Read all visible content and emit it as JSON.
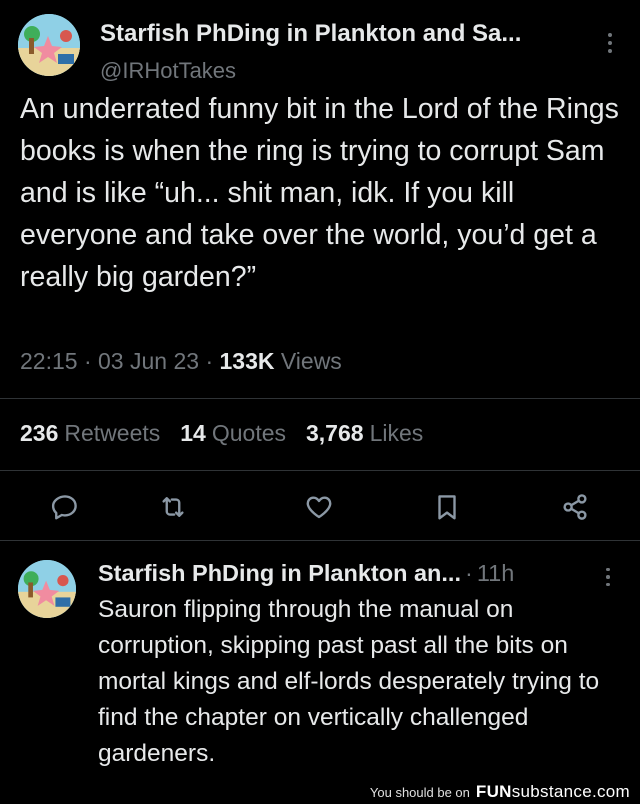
{
  "main_tweet": {
    "author_name": "Starfish PhDing in Plankton and Sa...",
    "author_handle": "@IRHotTakes",
    "text": "An underrated funny bit in the Lord of the Rings books is when the ring is trying to corrupt Sam and is like “uh... shit man, idk. If you kill everyone and take over the world, you’d get a really big garden?”",
    "time": "22:15",
    "date": "03 Jun 23",
    "views_count": "133K",
    "views_label": "Views",
    "separator": "·",
    "retweets_count": "236",
    "retweets_label": "Retweets",
    "quotes_count": "14",
    "quotes_label": "Quotes",
    "likes_count": "3,768",
    "likes_label": "Likes"
  },
  "actions": {
    "icons": [
      "reply-icon",
      "retweet-icon",
      "like-icon",
      "bookmark-icon",
      "share-icon"
    ],
    "icon_color": "#8b98a5"
  },
  "reply": {
    "author_name": "Starfish PhDing in Plankton an...",
    "separator": "·",
    "time": "11h",
    "text": "Sauron flipping through the manual on corruption, skipping past past all the bits on mortal kings and elf-lords desperately trying to find the chapter on vertically challenged gardeners."
  },
  "watermark": {
    "prefix": "You should be on",
    "brand_fun": "FUN",
    "brand_substance": "substance",
    "brand_tld": ".com"
  },
  "colors": {
    "background": "#000000",
    "text_primary": "#e7e9ea",
    "text_secondary": "#71767b",
    "divider": "#2f3336"
  }
}
